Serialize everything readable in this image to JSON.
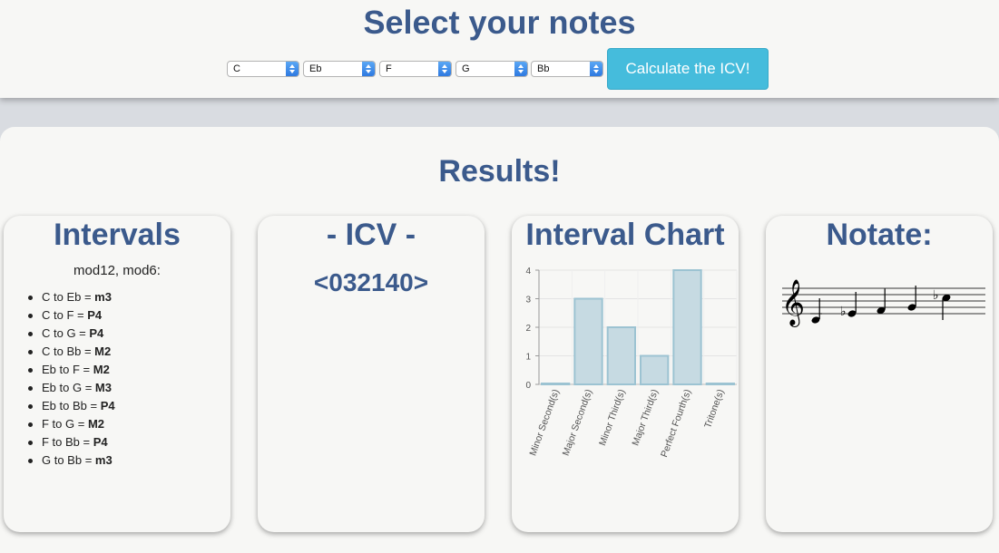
{
  "header": {
    "title": "Select your notes",
    "selects": [
      "C",
      "Eb",
      "F",
      "G",
      "Bb"
    ],
    "calculate_label": "Calculate the ICV!"
  },
  "results": {
    "title": "Results!",
    "intervals": {
      "title": "Intervals",
      "subtitle": "mod12, mod6:",
      "items": [
        {
          "text": "C to Eb = ",
          "value": "m3"
        },
        {
          "text": "C to F = ",
          "value": "P4"
        },
        {
          "text": "C to G = ",
          "value": "P4"
        },
        {
          "text": "C to Bb = ",
          "value": "M2"
        },
        {
          "text": "Eb to F = ",
          "value": "M2"
        },
        {
          "text": "Eb to G = ",
          "value": "M3"
        },
        {
          "text": "Eb to Bb = ",
          "value": "P4"
        },
        {
          "text": "F to G = ",
          "value": "M2"
        },
        {
          "text": "F to Bb = ",
          "value": "P4"
        },
        {
          "text": "G to Bb = ",
          "value": "m3"
        }
      ]
    },
    "icv": {
      "title": "- ICV -",
      "value": "<032140>"
    },
    "chart": {
      "title": "Interval Chart"
    },
    "notate": {
      "title": "Notate:",
      "notes": [
        "C",
        "Eb",
        "F",
        "G",
        "Bb"
      ]
    }
  },
  "colors": {
    "heading": "#3b5a8c",
    "button": "#45bcdc",
    "bar_fill": "#c6dae2",
    "bar_stroke": "#9cc3d2"
  },
  "chart_data": {
    "type": "bar",
    "title": "",
    "categories": [
      "Minor Second(s)",
      "Major Second(s)",
      "Minor Third(s)",
      "Major Third(s)",
      "Perfect Fourth(s)",
      "Tritone(s)"
    ],
    "values": [
      0,
      3,
      2,
      1,
      4,
      0
    ],
    "ylim": [
      0,
      4
    ],
    "yticks": [
      0,
      1,
      2,
      3,
      4
    ],
    "grid": true,
    "xlabel": "",
    "ylabel": ""
  }
}
